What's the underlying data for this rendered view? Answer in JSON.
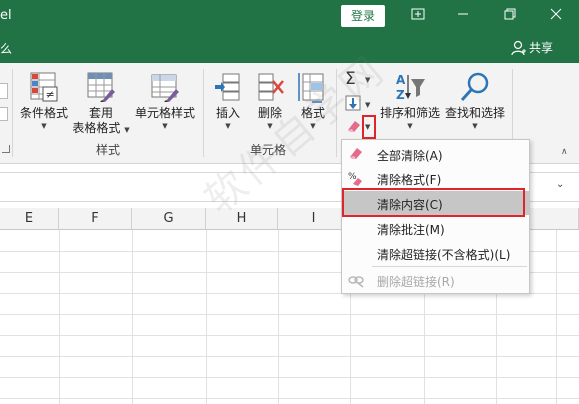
{
  "titlebar": {
    "app_title_fragment": "el",
    "login_label": "登录",
    "colors": {
      "brand": "#217346"
    }
  },
  "tabrow": {
    "tell_me_fragment": "么",
    "share_label": "共享"
  },
  "ribbon": {
    "styles_group": {
      "label": "样式",
      "conditional_format": "条件格式",
      "table_format_line1": "套用",
      "table_format_line2": "表格格式",
      "cell_styles": "单元格样式"
    },
    "cells_group": {
      "label": "单元格",
      "insert": "插入",
      "delete": "删除",
      "format": "格式"
    },
    "editing_group": {
      "sort_filter": "排序和筛选",
      "find_select": "查找和选择"
    }
  },
  "columns": [
    "E",
    "F",
    "G",
    "H",
    "I"
  ],
  "clear_menu": {
    "items": [
      {
        "label": "全部清除(A)",
        "icon": "eraser-icon",
        "enabled": true
      },
      {
        "label": "清除格式(F)",
        "icon": "clear-format-icon",
        "enabled": true
      },
      {
        "label": "清除内容(C)",
        "icon": "none",
        "enabled": true,
        "highlighted": true
      },
      {
        "label": "清除批注(M)",
        "icon": "none",
        "enabled": true
      },
      {
        "label": "清除超链接(不含格式)(L)",
        "icon": "none",
        "enabled": true
      },
      {
        "label": "删除超链接(R)",
        "icon": "remove-link-icon",
        "enabled": false
      }
    ]
  },
  "watermark": "软件自学网",
  "highlight_color": "#e0242b"
}
